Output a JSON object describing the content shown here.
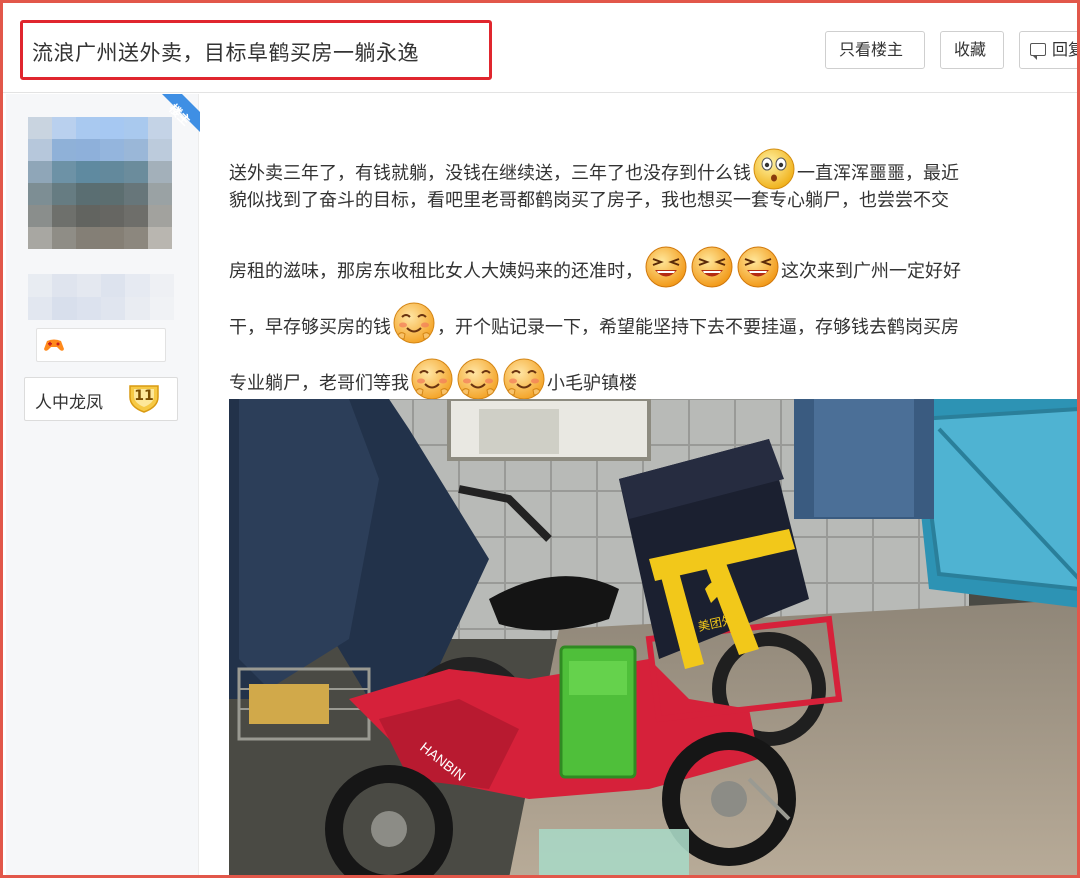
{
  "thread": {
    "title": "流浪广州送外卖，目标阜鹤买房一躺永逸",
    "buttons": {
      "only_op": "只看楼主",
      "favorite": "收藏",
      "reply": "回复"
    }
  },
  "author": {
    "op_ribbon": "楼主",
    "level_name": "人中龙凤",
    "level_number": "11"
  },
  "post": {
    "segments": {
      "l1a": "送外卖三年了，有钱就躺，没钱在继续送，三年了也没存到什么钱",
      "l1b": "一直浑浑噩噩，最近",
      "l2": "貌似找到了奋斗的目标，看吧里老哥都鹤岗买了房子，我也想买一套专心躺尸，也尝尝不交",
      "l3a": "房租的滋味，那房东收租比女人大姨妈来的还准时，",
      "l3b": "这次来到广州一定好好",
      "l4a": "干，早存够买房的钱",
      "l4b": "，开个贴记录一下，希望能坚持下去不要挂逼，存够钱去鹤岗买房",
      "l5a": "专业躺尸，老哥们等我",
      "l5b": "小毛驴镇楼"
    },
    "emoji_names": [
      "surprised-face",
      "laughing-face",
      "blushing-smile-face"
    ]
  },
  "photo": {
    "subject": "electric scooter with delivery box",
    "box_label": "美团外卖"
  },
  "colors": {
    "frame_border": "#e2574a",
    "title_highlight": "#e0262e",
    "op_ribbon": "#3f8fe4",
    "delivery_yellow": "#f2c81a",
    "scooter_red": "#d6213a"
  }
}
